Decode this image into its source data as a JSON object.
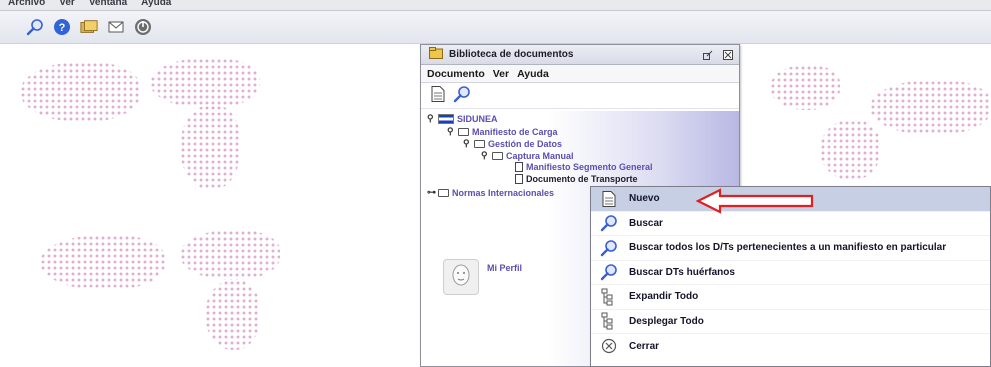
{
  "menubar": {
    "items": [
      "Archivo",
      "Ver",
      "Ventana",
      "Ayuda"
    ]
  },
  "toolbar": {
    "icons": [
      "search-icon",
      "help-icon",
      "folders-icon",
      "mail-icon",
      "power-icon"
    ]
  },
  "library_window": {
    "title": "Biblioteca de documentos",
    "menu": [
      "Documento",
      "Ver",
      "Ayuda"
    ],
    "tools": [
      "new-document-icon",
      "search-icon"
    ],
    "tree": {
      "root": "SIDUNEA",
      "manifiesto": "Manifiesto de Carga",
      "gestion": "Gestión de Datos",
      "captura": "Captura Manual",
      "segmento": "Manifiesto Segmento General",
      "documento": "Documento de Transporte",
      "normas": "Normas Internacionales",
      "perfil": "Mi Perfil"
    }
  },
  "context_menu": {
    "items": [
      {
        "label": "Nuevo",
        "icon": "new-document-icon",
        "active": true
      },
      {
        "label": "Buscar",
        "icon": "search-icon"
      },
      {
        "label": "Buscar todos los D/Ts pertenecientes a un manifiesto en particular",
        "icon": "search-icon"
      },
      {
        "label": "Buscar DTs huérfanos",
        "icon": "search-icon"
      },
      {
        "label": "Expandir Todo",
        "icon": "expand-tree-icon"
      },
      {
        "label": "Desplegar Todo",
        "icon": "collapse-tree-icon"
      },
      {
        "label": "Cerrar",
        "icon": "close-circle-icon"
      }
    ]
  },
  "colors": {
    "highlight": "#c6cfe4",
    "tree_text": "#5a4fb0",
    "arrow": "#e02020",
    "map_dots": "#c56fa6"
  }
}
